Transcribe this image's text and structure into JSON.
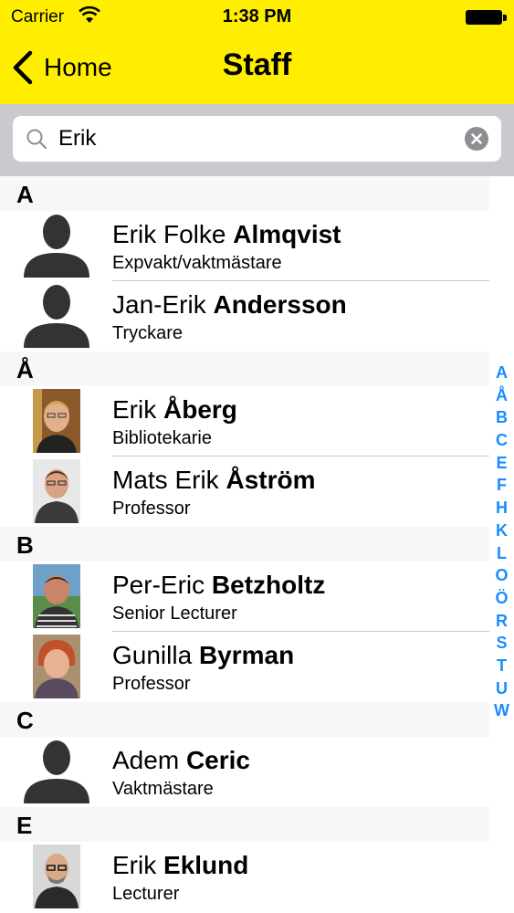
{
  "status_bar": {
    "carrier": "Carrier",
    "time": "1:38 PM"
  },
  "nav": {
    "back_label": "Home",
    "title": "Staff"
  },
  "search": {
    "value": "Erik"
  },
  "sections": [
    {
      "letter": "A",
      "people": [
        {
          "first": "Erik Folke",
          "last": "Almqvist",
          "role": "Expvakt/vaktmästare",
          "photo": "placeholder"
        },
        {
          "first": "Jan-Erik",
          "last": "Andersson",
          "role": "Tryckare",
          "photo": "placeholder"
        }
      ]
    },
    {
      "letter": "Å",
      "people": [
        {
          "first": "Erik",
          "last": "Åberg",
          "role": "Bibliotekarie",
          "photo": "photo"
        },
        {
          "first": "Mats Erik",
          "last": "Åström",
          "role": "Professor",
          "photo": "photo"
        }
      ]
    },
    {
      "letter": "B",
      "people": [
        {
          "first": "Per-Eric",
          "last": "Betzholtz",
          "role": "Senior Lecturer",
          "photo": "photo"
        },
        {
          "first": "Gunilla",
          "last": "Byrman",
          "role": "Professor",
          "photo": "photo"
        }
      ]
    },
    {
      "letter": "C",
      "people": [
        {
          "first": "Adem",
          "last": "Ceric",
          "role": "Vaktmästare",
          "photo": "placeholder"
        }
      ]
    },
    {
      "letter": "E",
      "people": [
        {
          "first": "Erik",
          "last": "Eklund",
          "role": "Lecturer",
          "photo": "photo"
        }
      ]
    }
  ],
  "index_letters": [
    "A",
    "Å",
    "B",
    "C",
    "E",
    "F",
    "H",
    "K",
    "L",
    "O",
    "Ö",
    "R",
    "S",
    "T",
    "U",
    "W"
  ],
  "colors": {
    "header": "#ffee00",
    "index": "#1a8cff",
    "search_bar": "#c9c9ce"
  }
}
